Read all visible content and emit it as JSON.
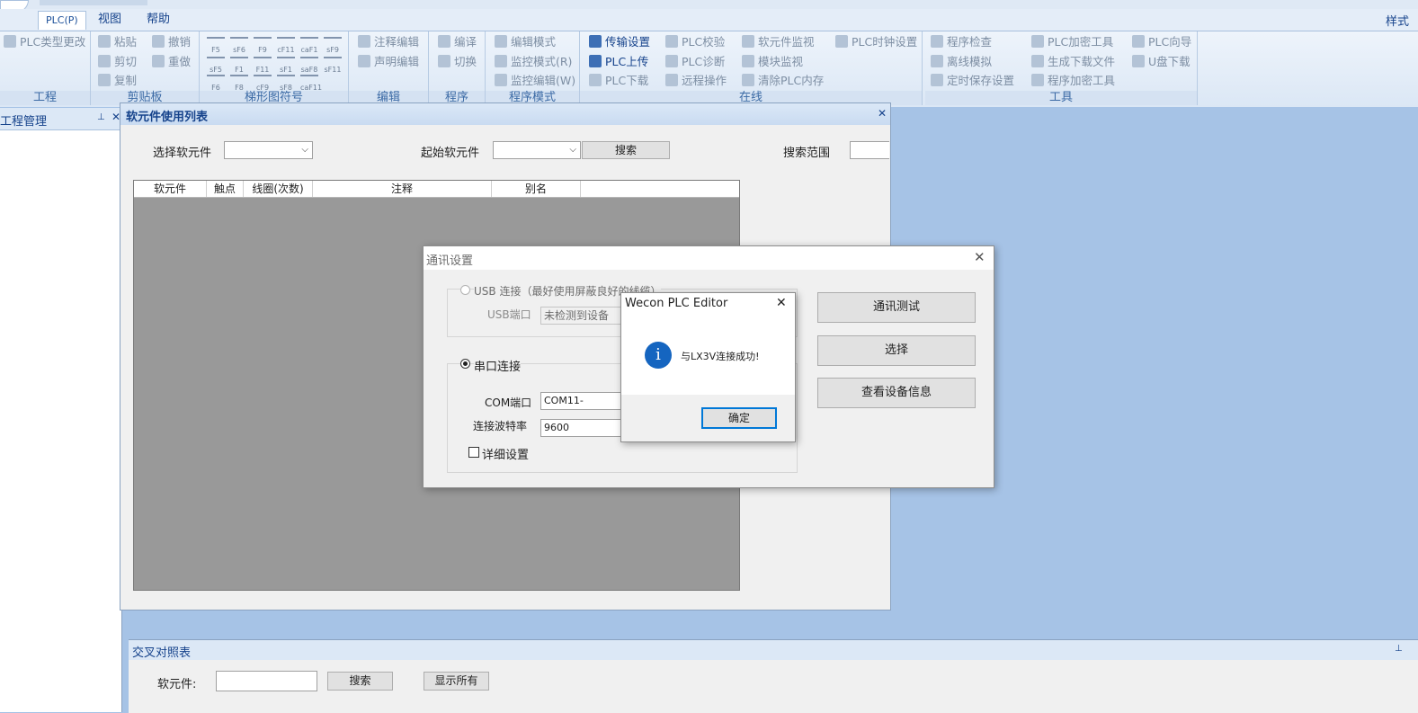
{
  "menu": {
    "tabs": [
      "PLC(P)",
      "视图",
      "帮助"
    ],
    "style": "样式"
  },
  "ribbon": {
    "project": {
      "label": "工程",
      "items": [
        "PLC类型更改"
      ]
    },
    "clipboard": {
      "label": "剪贴板",
      "items": [
        "粘贴",
        "剪切",
        "复制",
        "撤销",
        "重做"
      ]
    },
    "ladder": {
      "label": "梯形图符号",
      "symbols": [
        "F5",
        "sF6",
        "F9",
        "cF11",
        "caF1",
        "sF9",
        "sF5",
        "F1",
        "F11",
        "sF1",
        "saF8",
        "sF11",
        "F6",
        "F8",
        "cF9",
        "sF8",
        "caF11"
      ]
    },
    "edit": {
      "label": "编辑",
      "items": [
        "注释编辑",
        "声明编辑"
      ]
    },
    "program": {
      "label": "程序",
      "items": [
        "编译",
        "切换"
      ]
    },
    "mode": {
      "label": "程序模式",
      "items": [
        "编辑模式",
        "监控模式(R)",
        "监控编辑(W)"
      ]
    },
    "online": {
      "label": "在线",
      "items": [
        "传输设置",
        "PLC上传",
        "PLC下载",
        "PLC校验",
        "PLC诊断",
        "远程操作",
        "软元件监视",
        "模块监视",
        "清除PLC内存",
        "PLC时钟设置"
      ]
    },
    "tools": {
      "label": "工具",
      "items": [
        "程序检查",
        "离线模拟",
        "定时保存设置",
        "PLC加密工具",
        "生成下载文件",
        "程序加密工具",
        "PLC向导",
        "U盘下载"
      ]
    }
  },
  "left_panel": {
    "title": "工程管理"
  },
  "device_window": {
    "title": "软元件使用列表",
    "select_label": "选择软元件",
    "start_label": "起始软元件",
    "search_button": "搜索",
    "range_label": "搜索范围",
    "columns": [
      "软元件",
      "触点",
      "线圈(次数)",
      "注释",
      "别名"
    ]
  },
  "xref": {
    "title": "交叉对照表",
    "device_label": "软元件:",
    "search_button": "搜索",
    "show_all_button": "显示所有"
  },
  "comm_dialog": {
    "title": "通讯设置",
    "usb_label": "USB 连接（最好使用屏蔽良好的线缆）",
    "usb_port_label": "USB端口",
    "usb_port_value": "未检测到设备",
    "serial_label": "串口连接",
    "com_label": "COM端口",
    "com_value": "COM11-com0com",
    "baud_label": "连接波特率",
    "baud_value": "9600",
    "detail_label": "详细设置",
    "buttons": [
      "通讯测试",
      "选择",
      "查看设备信息"
    ]
  },
  "message_box": {
    "title": "Wecon PLC Editor",
    "message": "与LX3V连接成功!",
    "ok": "确定"
  }
}
